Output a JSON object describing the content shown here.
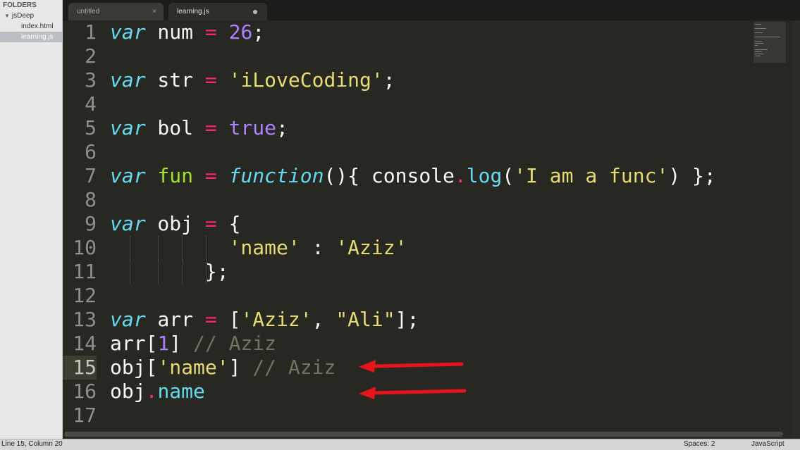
{
  "sidebar": {
    "header": "FOLDERS",
    "folder": "jsDeep",
    "files": [
      "index.html",
      "learning.js"
    ]
  },
  "tabs": [
    {
      "label": "untitled",
      "close": "×"
    },
    {
      "label": "learning.js"
    }
  ],
  "code": {
    "line_numbers": [
      "1",
      "2",
      "3",
      "4",
      "5",
      "6",
      "7",
      "8",
      "9",
      "10",
      "11",
      "12",
      "13",
      "14",
      "15",
      "16",
      "17"
    ],
    "current_line": 15,
    "lines": [
      [
        [
          "kw",
          "var"
        ],
        [
          "id",
          " num "
        ],
        [
          "op",
          "="
        ],
        [
          "id",
          " "
        ],
        [
          "num",
          "26"
        ],
        [
          "pn",
          ";"
        ]
      ],
      [],
      [
        [
          "kw",
          "var"
        ],
        [
          "id",
          " str "
        ],
        [
          "op",
          "="
        ],
        [
          "id",
          " "
        ],
        [
          "str",
          "'iLoveCoding'"
        ],
        [
          "pn",
          ";"
        ]
      ],
      [],
      [
        [
          "kw",
          "var"
        ],
        [
          "id",
          " bol "
        ],
        [
          "op",
          "="
        ],
        [
          "id",
          " "
        ],
        [
          "num",
          "true"
        ],
        [
          "pn",
          ";"
        ]
      ],
      [],
      [
        [
          "kw",
          "var"
        ],
        [
          "id",
          " "
        ],
        [
          "fn",
          "fun"
        ],
        [
          "id",
          " "
        ],
        [
          "op",
          "="
        ],
        [
          "id",
          " "
        ],
        [
          "fnk",
          "function"
        ],
        [
          "pn",
          "(){ console"
        ],
        [
          "op",
          "."
        ],
        [
          "prop",
          "log"
        ],
        [
          "pn",
          "("
        ],
        [
          "str",
          "'I am a func'"
        ],
        [
          "pn",
          ") };"
        ]
      ],
      [],
      [
        [
          "kw",
          "var"
        ],
        [
          "id",
          " obj "
        ],
        [
          "op",
          "="
        ],
        [
          "id",
          " {"
        ]
      ],
      [
        [
          "id",
          "          "
        ],
        [
          "str",
          "'name'"
        ],
        [
          "pn",
          " : "
        ],
        [
          "str",
          "'Aziz'"
        ]
      ],
      [
        [
          "id",
          "        };"
        ]
      ],
      [],
      [
        [
          "kw",
          "var"
        ],
        [
          "id",
          " arr "
        ],
        [
          "op",
          "="
        ],
        [
          "id",
          " ["
        ],
        [
          "str",
          "'Aziz'"
        ],
        [
          "pn",
          ", "
        ],
        [
          "str",
          "\"Ali\""
        ],
        [
          "pn",
          "];"
        ]
      ],
      [
        [
          "id",
          "arr["
        ],
        [
          "num",
          "1"
        ],
        [
          "id",
          "] "
        ],
        [
          "cm",
          "// Aziz"
        ]
      ],
      [
        [
          "id",
          "obj["
        ],
        [
          "str",
          "'name'"
        ],
        [
          "id",
          "] "
        ],
        [
          "cm",
          "// Aziz"
        ]
      ],
      [
        [
          "id",
          "obj"
        ],
        [
          "op",
          "."
        ],
        [
          "prop",
          "name"
        ]
      ],
      []
    ]
  },
  "status": {
    "position": "Line 15, Column 20",
    "spaces": "Spaces: 2",
    "syntax": "JavaScript"
  },
  "colors": {
    "background": "#272822",
    "keyword": "#66d9ef",
    "operator": "#f92672",
    "number": "#ae81ff",
    "string": "#e6db74",
    "comment": "#75715e",
    "arrow": "#e8141b"
  }
}
